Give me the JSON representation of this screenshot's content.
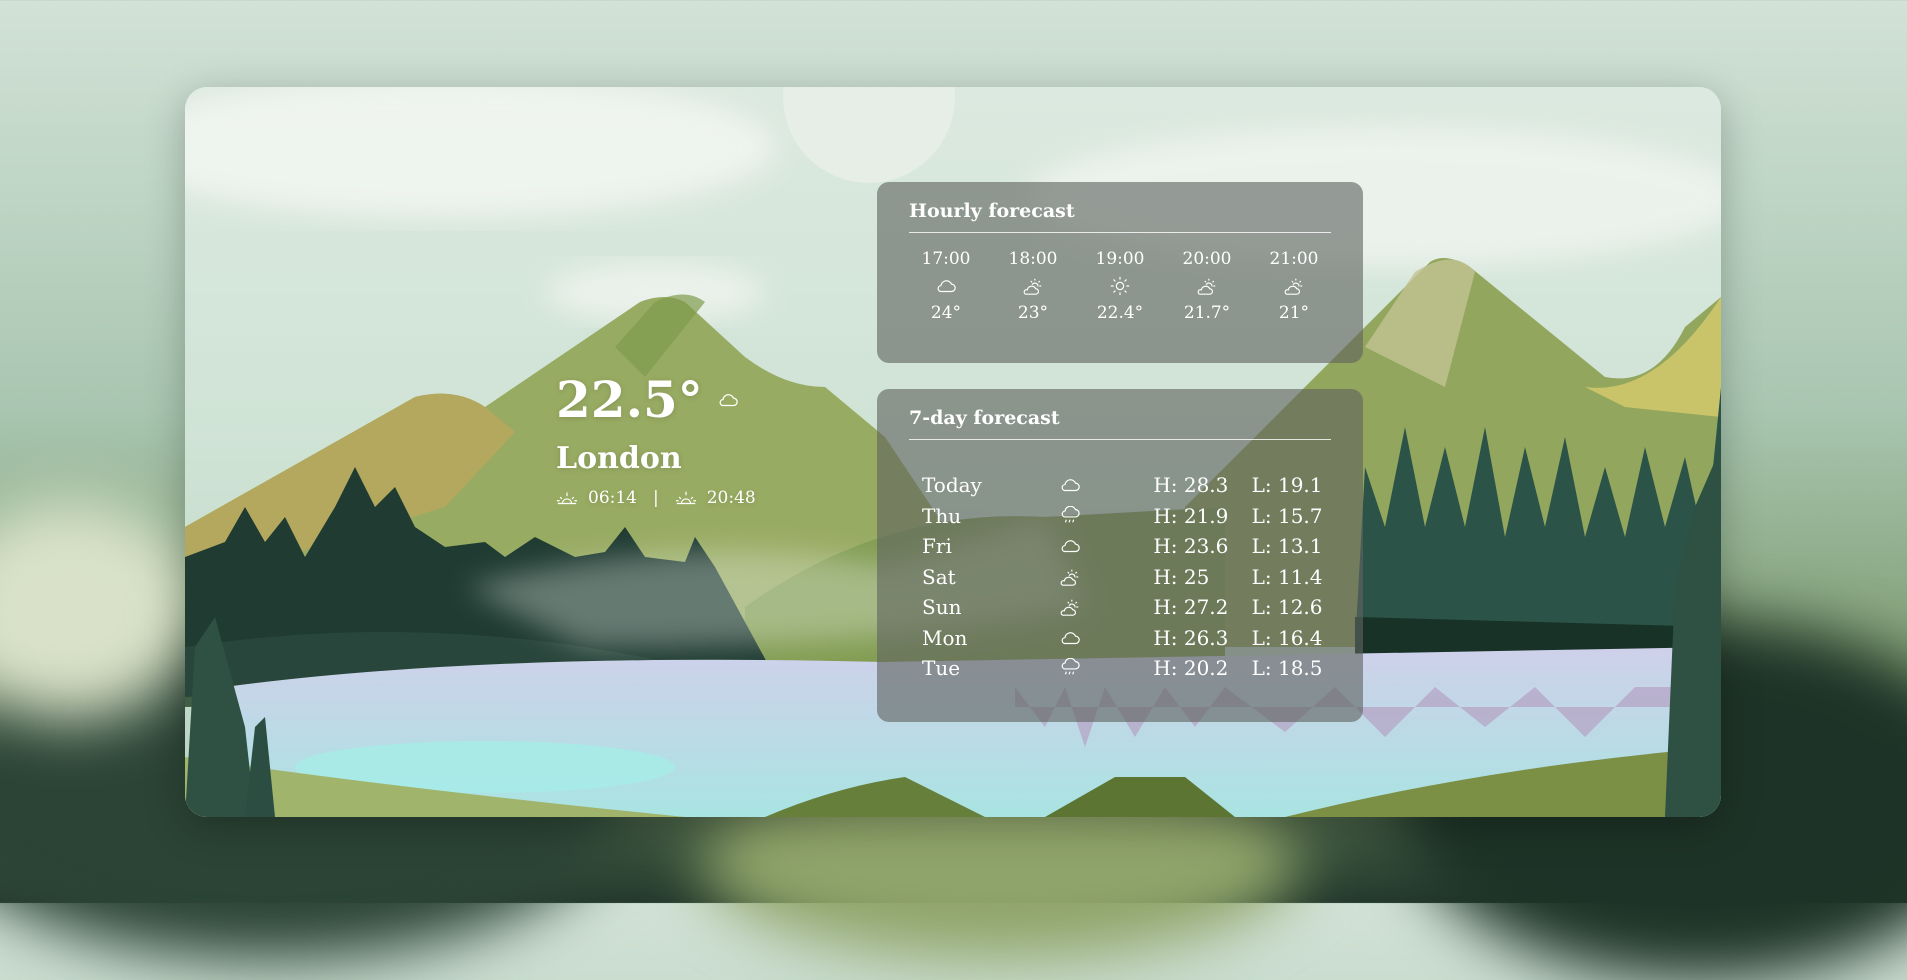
{
  "current": {
    "temperature": "22.5°",
    "condition_icon": "cloud-icon",
    "city": "London",
    "sunrise": "06:14",
    "separator": "|",
    "sunset": "20:48"
  },
  "hourly": {
    "title": "Hourly forecast",
    "items": [
      {
        "time": "17:00",
        "icon": "cloud-icon",
        "temp": "24°"
      },
      {
        "time": "18:00",
        "icon": "partly-cloudy-icon",
        "temp": "23°"
      },
      {
        "time": "19:00",
        "icon": "sun-icon",
        "temp": "22.4°"
      },
      {
        "time": "20:00",
        "icon": "partly-cloudy-icon",
        "temp": "21.7°"
      },
      {
        "time": "21:00",
        "icon": "partly-cloudy-icon",
        "temp": "21°"
      }
    ]
  },
  "weekly": {
    "title": "7-day forecast",
    "days": [
      {
        "day": "Today",
        "icon": "cloud-icon",
        "high": "H: 28.3",
        "low": "L: 19.1"
      },
      {
        "day": "Thu",
        "icon": "rain-icon",
        "high": "H: 21.9",
        "low": "L: 15.7"
      },
      {
        "day": "Fri",
        "icon": "cloud-icon",
        "high": "H: 23.6",
        "low": "L: 13.1"
      },
      {
        "day": "Sat",
        "icon": "partly-cloudy-icon",
        "high": "H: 25",
        "low": "L: 11.4"
      },
      {
        "day": "Sun",
        "icon": "partly-cloudy-icon",
        "high": "H: 27.2",
        "low": "L: 12.6"
      },
      {
        "day": "Mon",
        "icon": "cloud-icon",
        "high": "H: 26.3",
        "low": "L: 16.4"
      },
      {
        "day": "Tue",
        "icon": "rain-icon",
        "high": "H: 20.2",
        "low": "L: 18.5"
      }
    ]
  }
}
